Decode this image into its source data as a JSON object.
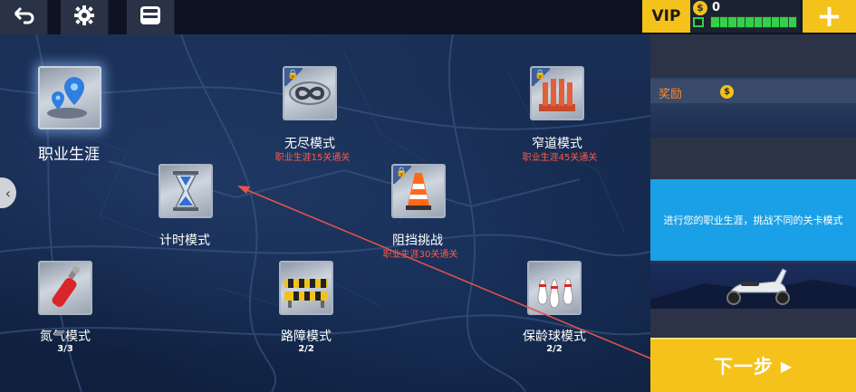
{
  "topbar": {
    "back_icon": "back-arrow-icon",
    "settings_icon": "gear-icon",
    "garage_icon": "garage-icon",
    "vip_label": "VIP",
    "coin_icon": "dollar-coin-icon",
    "coins": "0",
    "plus_label": "+"
  },
  "modes": [
    {
      "name": "职业生涯",
      "sub": "",
      "count": "",
      "locked": false,
      "icon": "map-pins-icon"
    },
    {
      "name": "无尽模式",
      "sub": "职业生涯15关通关",
      "count": "",
      "locked": true,
      "icon": "infinity-icon"
    },
    {
      "name": "窄道模式",
      "sub": "职业生涯45关通关",
      "count": "",
      "locked": true,
      "icon": "barrier-icon"
    },
    {
      "name": "计时模式",
      "sub": "",
      "count": "",
      "locked": false,
      "icon": "hourglass-icon"
    },
    {
      "name": "阻挡挑战",
      "sub": "职业生涯30关通关",
      "count": "",
      "locked": true,
      "icon": "traffic-cone-icon"
    },
    {
      "name": "氮气模式",
      "sub": "",
      "count": "3/3",
      "locked": false,
      "icon": "nitro-tank-icon"
    },
    {
      "name": "路障模式",
      "sub": "",
      "count": "2/2",
      "locked": false,
      "icon": "roadblock-icon"
    },
    {
      "name": "保龄球模式",
      "sub": "",
      "count": "2/2",
      "locked": false,
      "icon": "bowling-pins-icon"
    }
  ],
  "side": {
    "reward_label": "奖励",
    "reward_coin_glyph": "$",
    "description": "进行您的职业生涯，挑战不同的关卡模式",
    "next_label": "下一步"
  },
  "colors": {
    "accent": "#f4c21a",
    "locked_text": "#ff5a45",
    "info_blue": "#1aa0e6"
  }
}
